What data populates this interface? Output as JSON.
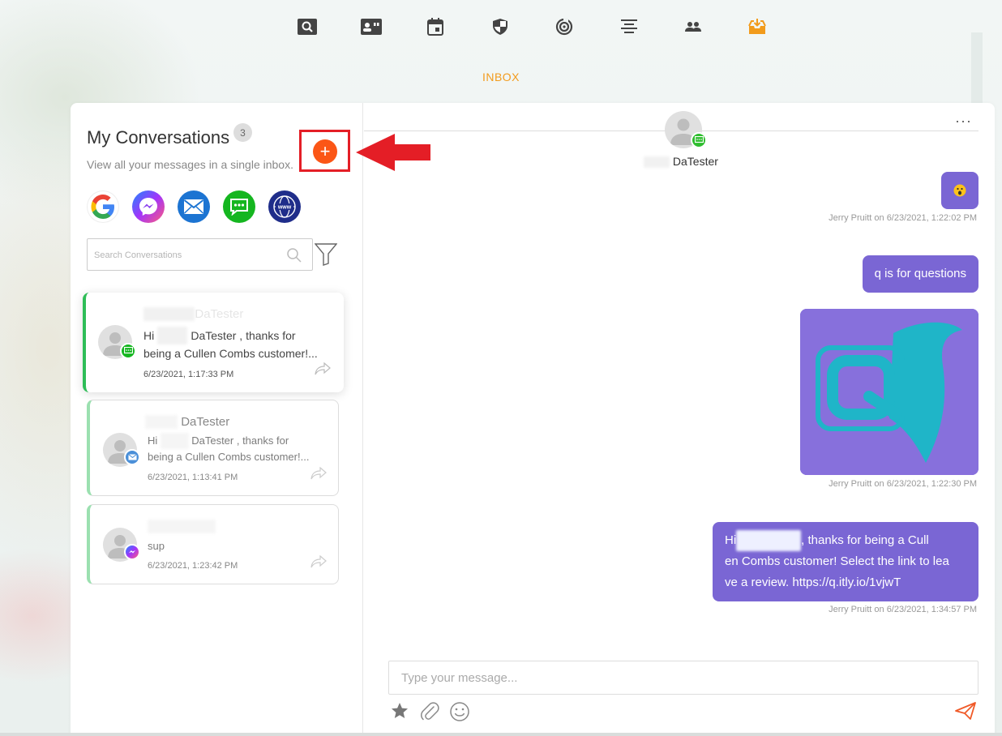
{
  "colors": {
    "accent": "#f29b1c",
    "add_button": "#fb5616",
    "highlight_box": "#e41e26",
    "bubble": "#7a66d4",
    "active_bar": "#2ebd57",
    "send": "#f05a28"
  },
  "nav": {
    "icons": [
      "search-icon",
      "contact-card-icon",
      "calendar-icon",
      "shield-icon",
      "target-icon",
      "align-center-icon",
      "people-icon",
      "inbox-icon"
    ],
    "active": "inbox-icon",
    "title": "INBOX"
  },
  "sidebar": {
    "title": "My Conversations",
    "count": "3",
    "subtitle": "View all your messages in a single inbox.",
    "add_button_label": "+",
    "channels": [
      "google-icon",
      "messenger-icon",
      "email-icon",
      "sms-icon",
      "web-icon"
    ],
    "search_placeholder": "Search Conversations",
    "conversations": [
      {
        "name_visible": "DaTester",
        "msg_start": "Hi",
        "msg_mid": "DaTester , thanks for",
        "msg_line2": "being a Cullen Combs customer!...",
        "time": "6/23/2021, 1:17:33 PM",
        "channel": "sms-icon"
      },
      {
        "name_visible": "DaTester",
        "msg_start": "Hi",
        "msg_mid": "DaTester , thanks for",
        "msg_line2": "being a Cullen Combs customer!...",
        "time": "6/23/2021, 1:13:41 PM",
        "channel": "email-icon"
      },
      {
        "msg": "sup",
        "time": "6/23/2021, 1:23:42 PM",
        "channel": "messenger-icon"
      }
    ]
  },
  "chat": {
    "contact_name": "DaTester",
    "more_label": "···",
    "messages": [
      {
        "type": "emoji",
        "text": "😮",
        "meta": "Jerry Pruitt on 6/23/2021, 1:22:02 PM"
      },
      {
        "type": "text",
        "text": "q is for questions",
        "meta": ""
      },
      {
        "type": "image",
        "alt": "Q logo",
        "meta": "Jerry Pruitt on 6/23/2021, 1:22:30 PM"
      },
      {
        "type": "text",
        "line1_start": "Hi",
        "line1_end": ", thanks for being a Cull",
        "line2": "en Combs customer! Select the link to lea",
        "line3": "ve a review. https://q.itly.io/1vjwT",
        "meta": "Jerry Pruitt on 6/23/2021, 1:34:57 PM"
      }
    ],
    "composer_placeholder": "Type your message..."
  }
}
